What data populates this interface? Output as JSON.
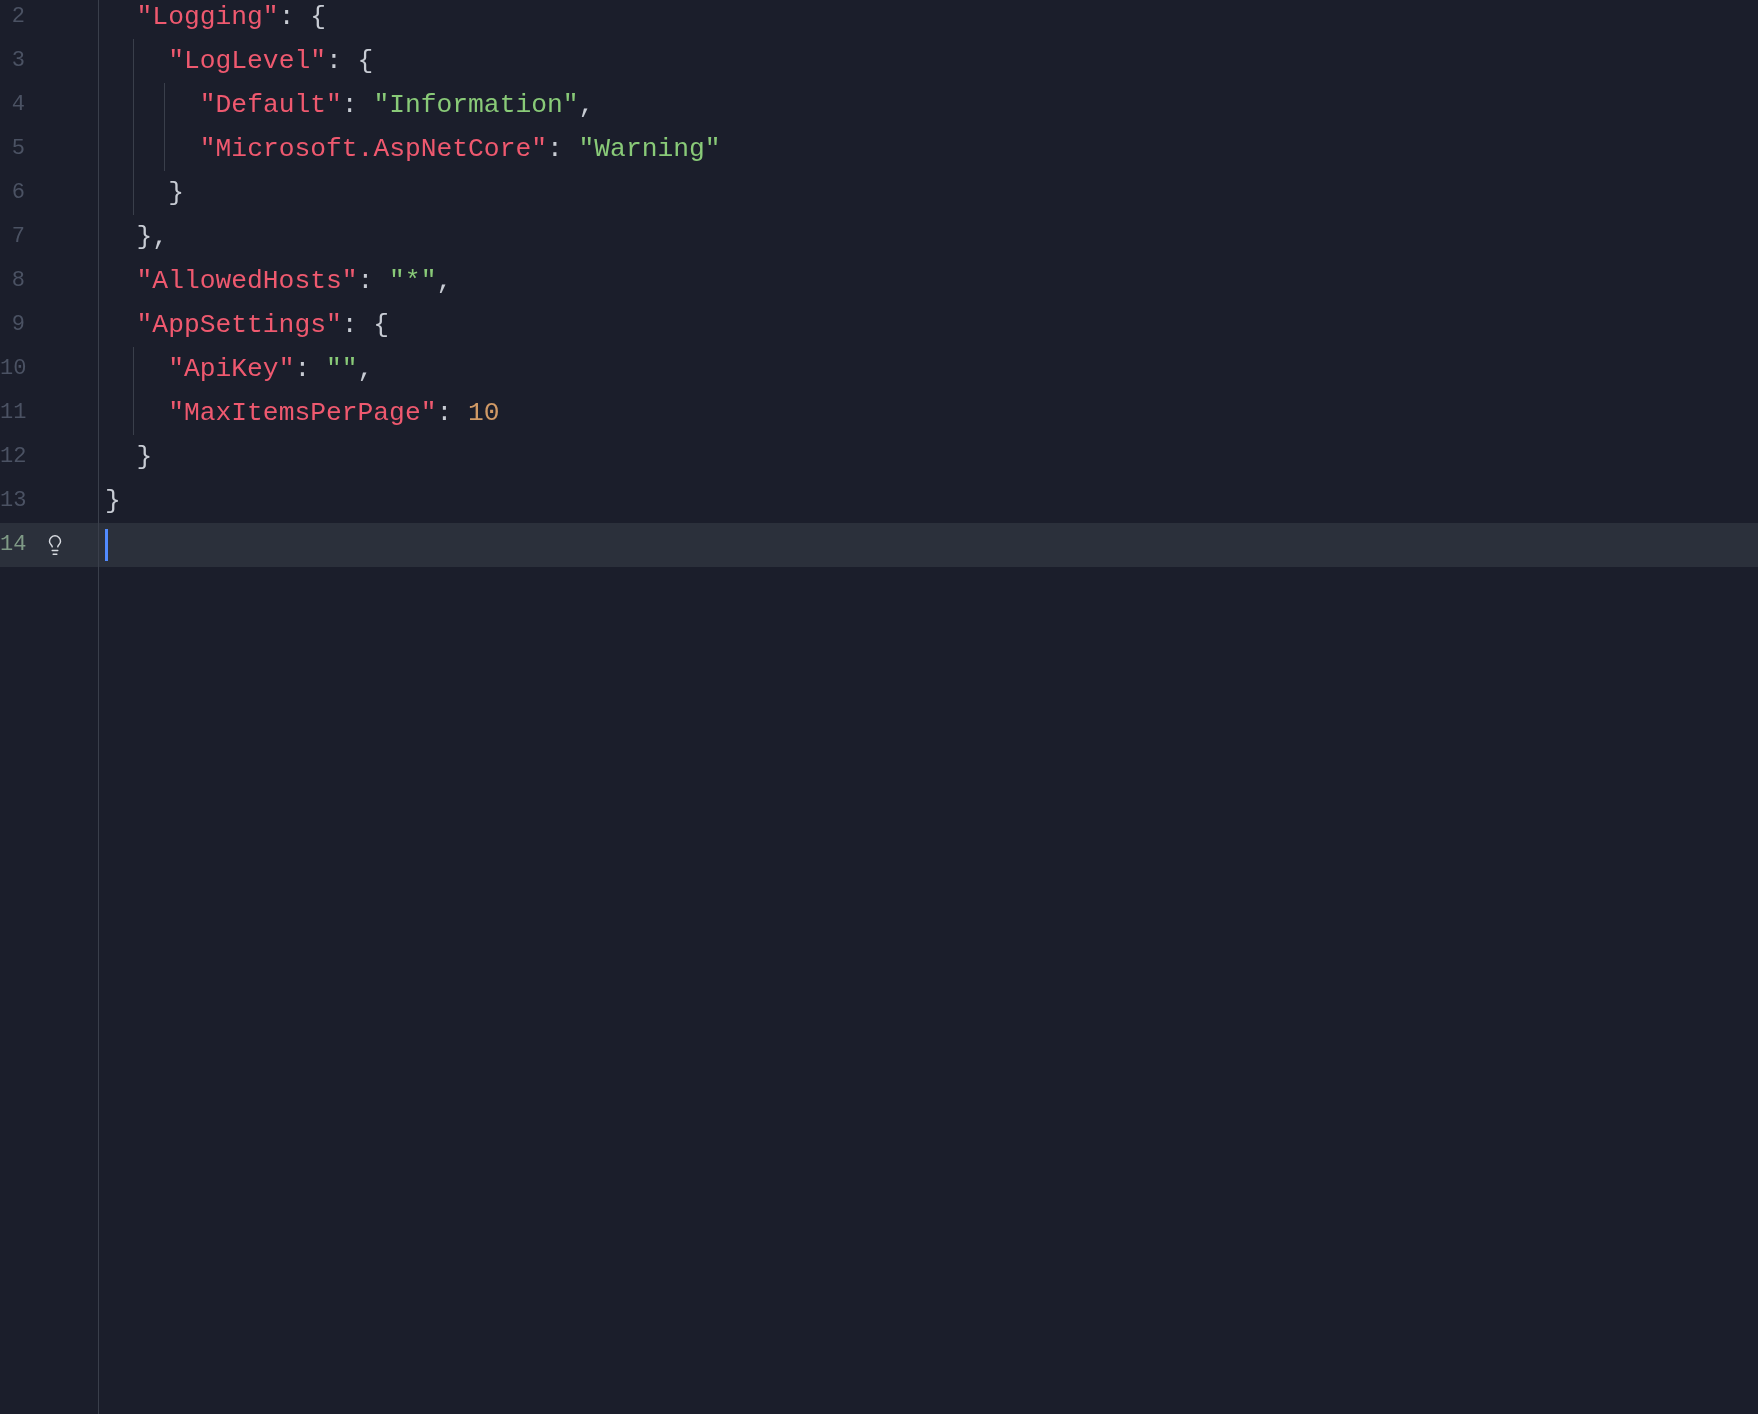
{
  "editor": {
    "lines": [
      {
        "children": [
          {
            "number": "2",
            "current": false,
            "tokens": [
              {
                "kind": "key",
                "text": "\"Logging\""
              },
              {
                "kind": "punct",
                "text": ": {"
              }
            ],
            "children": [
              {
                "number": "3",
                "current": false,
                "tokens": [
                  {
                    "kind": "key",
                    "text": "\"LogLevel\""
                  },
                  {
                    "kind": "punct",
                    "text": ": {"
                  }
                ],
                "children": [
                  {
                    "number": "4",
                    "current": false,
                    "tokens": [
                      {
                        "kind": "key",
                        "text": "\"Default\""
                      },
                      {
                        "kind": "punct",
                        "text": ": "
                      },
                      {
                        "kind": "string",
                        "text": "\"Information\""
                      },
                      {
                        "kind": "punct",
                        "text": ","
                      }
                    ]
                  },
                  {
                    "number": "5",
                    "current": false,
                    "tokens": [
                      {
                        "kind": "key",
                        "text": "\"Microsoft.AspNetCore\""
                      },
                      {
                        "kind": "punct",
                        "text": ": "
                      },
                      {
                        "kind": "string",
                        "text": "\"Warning\""
                      }
                    ]
                  }
                ]
              },
              {
                "number": "6",
                "current": false,
                "tokens": [
                  {
                    "kind": "punct",
                    "text": "}"
                  }
                ]
              }
            ]
          },
          {
            "number": "7",
            "current": false,
            "tokens": [
              {
                "kind": "punct",
                "text": "},"
              }
            ]
          },
          {
            "number": "8",
            "current": false,
            "tokens": [
              {
                "kind": "key",
                "text": "\"AllowedHosts\""
              },
              {
                "kind": "punct",
                "text": ": "
              },
              {
                "kind": "string",
                "text": "\"*\""
              },
              {
                "kind": "punct",
                "text": ","
              }
            ]
          },
          {
            "number": "9",
            "current": false,
            "tokens": [
              {
                "kind": "key",
                "text": "\"AppSettings\""
              },
              {
                "kind": "punct",
                "text": ": {"
              }
            ],
            "children": [
              {
                "number": "10",
                "current": false,
                "tokens": [
                  {
                    "kind": "key",
                    "text": "\"ApiKey\""
                  },
                  {
                    "kind": "punct",
                    "text": ": "
                  },
                  {
                    "kind": "string",
                    "text": "\"\""
                  },
                  {
                    "kind": "punct",
                    "text": ","
                  }
                ]
              },
              {
                "number": "11",
                "current": false,
                "tokens": [
                  {
                    "kind": "key",
                    "text": "\"MaxItemsPerPage\""
                  },
                  {
                    "kind": "punct",
                    "text": ": "
                  },
                  {
                    "kind": "number",
                    "text": "10"
                  }
                ]
              }
            ]
          },
          {
            "number": "12",
            "current": false,
            "tokens": [
              {
                "kind": "punct",
                "text": "}"
              }
            ]
          }
        ]
      },
      {
        "number": "13",
        "current": false,
        "tokens": [
          {
            "kind": "punct",
            "text": "}"
          }
        ]
      },
      {
        "number": "14",
        "current": true,
        "bulb": true
      }
    ]
  }
}
